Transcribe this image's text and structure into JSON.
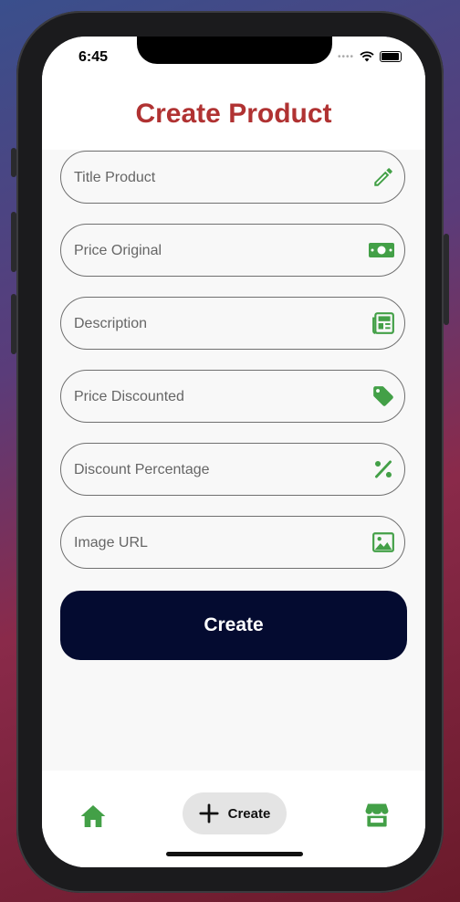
{
  "status_bar": {
    "time": "6:45"
  },
  "header": {
    "title": "Create Product"
  },
  "form": {
    "fields": [
      {
        "placeholder": "Title Product",
        "value": "",
        "icon": "pencil-icon"
      },
      {
        "placeholder": "Price Original",
        "value": "",
        "icon": "money-bill-icon"
      },
      {
        "placeholder": "Description",
        "value": "",
        "icon": "newspaper-icon"
      },
      {
        "placeholder": "Price Discounted",
        "value": "",
        "icon": "tag-icon"
      },
      {
        "placeholder": "Discount Percentage",
        "value": "",
        "icon": "percent-icon"
      },
      {
        "placeholder": "Image URL",
        "value": "",
        "icon": "image-icon"
      }
    ],
    "submit_label": "Create"
  },
  "bottom_nav": {
    "home_icon": "home-icon",
    "create_label": "Create",
    "create_icon": "plus-icon",
    "store_icon": "store-icon"
  },
  "colors": {
    "title": "#b03232",
    "icon_green": "#43a047",
    "button_bg": "#040b30",
    "field_border": "#707070"
  }
}
